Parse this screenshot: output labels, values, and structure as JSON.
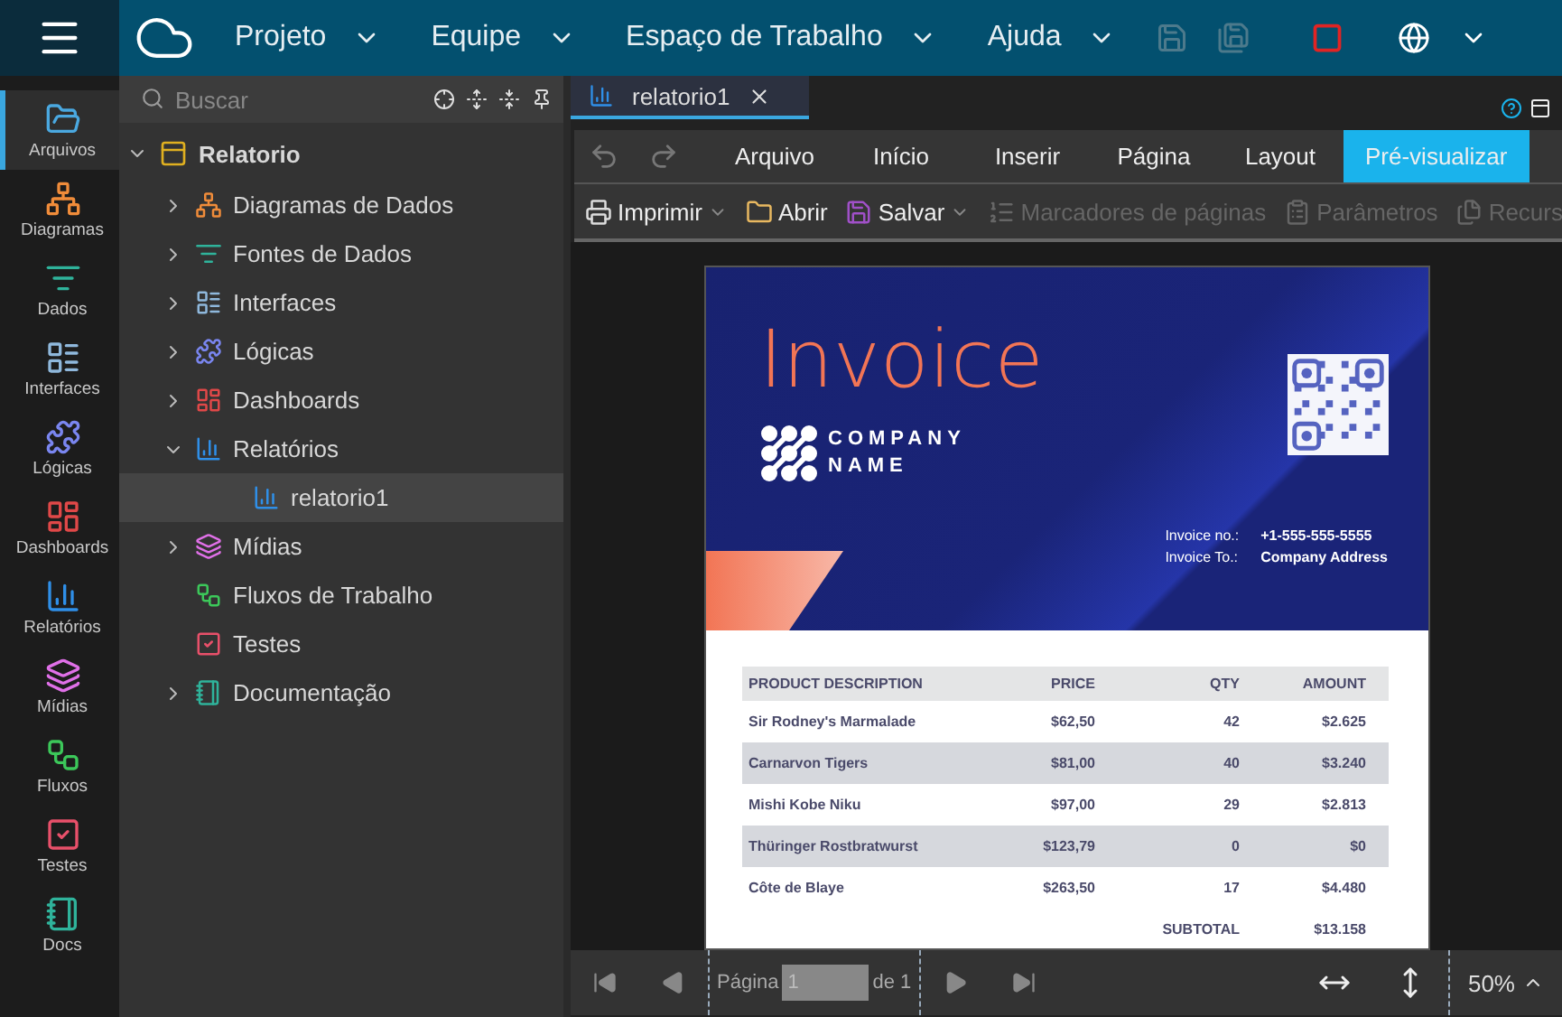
{
  "topbar": {
    "menus": [
      {
        "label": "Projeto"
      },
      {
        "label": "Equipe"
      },
      {
        "label": "Espaço de Trabalho"
      },
      {
        "label": "Ajuda"
      }
    ]
  },
  "rail": [
    {
      "kind": "files",
      "label": "Arquivos",
      "selected": true,
      "color": "#4aa8e0"
    },
    {
      "kind": "diagrams",
      "label": "Diagramas",
      "selected": false,
      "color": "#f08c3a"
    },
    {
      "kind": "data",
      "label": "Dados",
      "selected": false,
      "color": "#2fb39b"
    },
    {
      "kind": "interfaces",
      "label": "Interfaces",
      "selected": false,
      "color": "#8fb8dc"
    },
    {
      "kind": "logic",
      "label": "Lógicas",
      "selected": false,
      "color": "#7a86f0"
    },
    {
      "kind": "dashboards",
      "label": "Dashboards",
      "selected": false,
      "color": "#e04848"
    },
    {
      "kind": "reports",
      "label": "Relatórios",
      "selected": false,
      "color": "#2f8fe8"
    },
    {
      "kind": "media",
      "label": "Mídias",
      "selected": false,
      "color": "#e070e8"
    },
    {
      "kind": "flows",
      "label": "Fluxos",
      "selected": false,
      "color": "#3cc85a"
    },
    {
      "kind": "tests",
      "label": "Testes",
      "selected": false,
      "color": "#e8506a"
    },
    {
      "kind": "docs",
      "label": "Docs",
      "selected": false,
      "color": "#2fb39b"
    }
  ],
  "tree": {
    "search": {
      "placeholder": "Buscar"
    },
    "root": {
      "label": "Relatorio",
      "expanded": true,
      "children": [
        {
          "kind": "diagrams",
          "label": "Diagramas de Dados",
          "expanded": false,
          "selected": false,
          "color": "#f08c3a"
        },
        {
          "kind": "data",
          "label": "Fontes de Dados",
          "expanded": false,
          "selected": false,
          "color": "#2fb39b"
        },
        {
          "kind": "interfaces",
          "label": "Interfaces",
          "expanded": false,
          "selected": false,
          "color": "#8fb8dc"
        },
        {
          "kind": "logic",
          "label": "Lógicas",
          "expanded": false,
          "selected": false,
          "color": "#7a86f0"
        },
        {
          "kind": "dashboards",
          "label": "Dashboards",
          "expanded": false,
          "selected": false,
          "color": "#e04848"
        },
        {
          "kind": "reports",
          "label": "Relatórios",
          "expanded": true,
          "selected": false,
          "color": "#2f8fe8",
          "children": [
            {
              "kind": "reports",
              "label": "relatorio1",
              "selected": true,
              "color": "#2f8fe8"
            }
          ]
        },
        {
          "kind": "media",
          "label": "Mídias",
          "expanded": false,
          "selected": false,
          "color": "#e070e8"
        },
        {
          "kind": "flows",
          "label": "Fluxos de Trabalho",
          "selected": false,
          "color": "#3cc85a"
        },
        {
          "kind": "tests",
          "label": "Testes",
          "selected": false,
          "color": "#e8506a"
        },
        {
          "kind": "docs",
          "label": "Documentação",
          "expanded": false,
          "selected": false,
          "color": "#2fb39b"
        }
      ]
    }
  },
  "editor_tab": {
    "label": "relatorio1"
  },
  "ribbon_tabs": [
    {
      "label": "Arquivo",
      "selected": false
    },
    {
      "label": "Início",
      "selected": false
    },
    {
      "label": "Inserir",
      "selected": false
    },
    {
      "label": "Página",
      "selected": false
    },
    {
      "label": "Layout",
      "selected": false
    },
    {
      "label": "Pré-visualizar",
      "selected": true
    }
  ],
  "toolbar": [
    {
      "kind": "print",
      "label": "Imprimir",
      "disabled": false,
      "dropdown": true
    },
    {
      "kind": "open",
      "label": "Abrir",
      "disabled": false,
      "dropdown": false
    },
    {
      "kind": "save",
      "label": "Salvar",
      "disabled": false,
      "dropdown": true
    },
    {
      "kind": "bookmarks",
      "label": "Marcadores de páginas",
      "disabled": true,
      "dropdown": false
    },
    {
      "kind": "params",
      "label": "Parâmetros",
      "disabled": true,
      "dropdown": false
    },
    {
      "kind": "resources",
      "label": "Recurs",
      "disabled": true,
      "dropdown": false
    }
  ],
  "invoice": {
    "title": "Invoice",
    "company": [
      "COMPANY",
      "NAME"
    ],
    "meta": [
      {
        "label": "Invoice no.:",
        "value": "+1-555-555-5555"
      },
      {
        "label": "Invoice To.:",
        "value": "Company Address"
      }
    ],
    "columns": [
      "PRODUCT DESCRIPTION",
      "PRICE",
      "QTY",
      "AMOUNT"
    ],
    "rows": [
      [
        "Sir Rodney's Marmalade",
        "$62,50",
        "42",
        "$2.625"
      ],
      [
        "Carnarvon Tigers",
        "$81,00",
        "40",
        "$3.240"
      ],
      [
        "Mishi Kobe Niku",
        "$97,00",
        "29",
        "$2.813"
      ],
      [
        "Thüringer Rostbratwurst",
        "$123,79",
        "0",
        "$0"
      ],
      [
        "Côte de Blaye",
        "$263,50",
        "17",
        "$4.480"
      ]
    ],
    "subtotal": {
      "label": "SUBTOTAL",
      "value": "$13.158"
    }
  },
  "pager": {
    "page_label": "Página",
    "page": "1",
    "of_label": "de 1",
    "zoom": "50%"
  }
}
